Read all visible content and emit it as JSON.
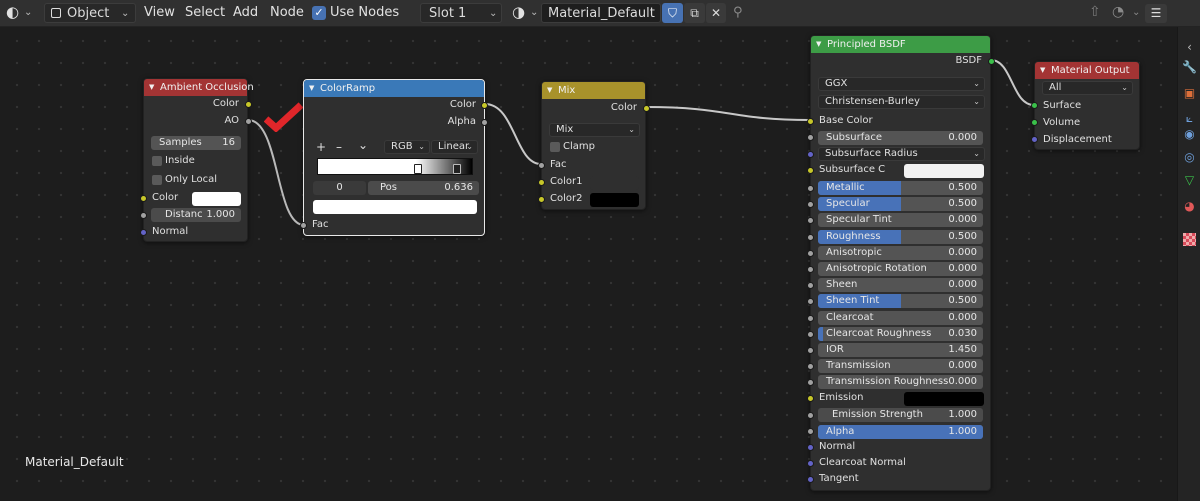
{
  "header": {
    "mode": "Object",
    "menus": [
      "View",
      "Select",
      "Add",
      "Node"
    ],
    "use_nodes_label": "Use Nodes",
    "slot": "Slot 1",
    "material": "Material_Default"
  },
  "canvas": {
    "material_label": "Material_Default"
  },
  "icons": [
    "editor-type-icon",
    "material-sphere-icon",
    "fake-user-shield-icon",
    "duplicate-icon",
    "close-icon",
    "pin-icon",
    "parent-up-icon",
    "backdrop-icon",
    "sidebar-toggle-icon",
    "tool-icon",
    "view-icon",
    "object-icon",
    "physics-icon",
    "constraint-icon",
    "data-icon",
    "material-icon",
    "texture-icon"
  ],
  "colors": {
    "ao_header": "#a33434",
    "colorramp_header": "#3a79b8",
    "mix_header": "#a8922b",
    "bsdf_header": "#3d9c46",
    "output_header": "#a33434",
    "slider_fill": "#4872b8",
    "socket_color": "#c7c729",
    "socket_float": "#a1a1a1",
    "socket_vector": "#6363c7",
    "socket_shader": "#3ac04a",
    "checkmark": "#e0262a"
  },
  "nodes": {
    "ao": {
      "title": "Ambient Occlusion",
      "out_color": "Color",
      "out_ao": "AO",
      "samples_label": "Samples",
      "samples_value": "16",
      "inside": "Inside",
      "only_local": "Only Local",
      "in_color": "Color",
      "distance_label": "Distanc",
      "distance_value": "1.000",
      "normal": "Normal"
    },
    "colorramp": {
      "title": "ColorRamp",
      "out_color": "Color",
      "out_alpha": "Alpha",
      "plus": "+",
      "minus": "–",
      "caret": "⌄",
      "color_mode": "RGB",
      "interpolation": "Linear",
      "index": "0",
      "pos_label": "Pos",
      "pos_value": "0.636",
      "fac": "Fac"
    },
    "mix": {
      "title": "Mix",
      "out_color": "Color",
      "blend": "Mix",
      "clamp": "Clamp",
      "fac": "Fac",
      "color1": "Color1",
      "color2": "Color2"
    },
    "bsdf": {
      "title": "Principled BSDF",
      "out": "BSDF",
      "distribution": "GGX",
      "subsurface_method": "Christensen-Burley",
      "base_color": "Base Color",
      "subsurface_label": "Subsurface",
      "subsurface_value": "0.000",
      "subsurface_radius": "Subsurface Radius",
      "subsurface_color": "Subsurface C",
      "sliders": [
        {
          "name": "Metallic",
          "value": "0.500",
          "fill": 0.5
        },
        {
          "name": "Specular",
          "value": "0.500",
          "fill": 0.5
        },
        {
          "name": "Specular Tint",
          "value": "0.000",
          "fill": 0
        },
        {
          "name": "Roughness",
          "value": "0.500",
          "fill": 0.5
        },
        {
          "name": "Anisotropic",
          "value": "0.000",
          "fill": 0
        },
        {
          "name": "Anisotropic Rotation",
          "value": "0.000",
          "fill": 0
        },
        {
          "name": "Sheen",
          "value": "0.000",
          "fill": 0
        },
        {
          "name": "Sheen Tint",
          "value": "0.500",
          "fill": 0.5
        },
        {
          "name": "Clearcoat",
          "value": "0.000",
          "fill": 0
        },
        {
          "name": "Clearcoat Roughness",
          "value": "0.030",
          "fill": 0.03
        },
        {
          "name": "IOR",
          "value": "1.450",
          "fill": 0
        },
        {
          "name": "Transmission",
          "value": "0.000",
          "fill": 0
        },
        {
          "name": "Transmission Roughness",
          "value": "0.000",
          "fill": 0
        }
      ],
      "emission": "Emission",
      "emission_strength_label": "Emission Strength",
      "emission_strength_value": "1.000",
      "alpha_label": "Alpha",
      "alpha_value": "1.000",
      "alpha_fill": 1,
      "normal": "Normal",
      "clearcoat_normal": "Clearcoat Normal",
      "tangent": "Tangent"
    },
    "output": {
      "title": "Material Output",
      "target": "All",
      "surface": "Surface",
      "volume": "Volume",
      "displacement": "Displacement"
    }
  }
}
